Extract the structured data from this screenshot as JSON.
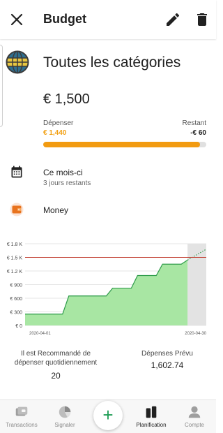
{
  "appbar": {
    "title": "Budget"
  },
  "budget": {
    "category": "Toutes les catégories",
    "amount": "€ 1,500",
    "spent_label": "Dépenser",
    "spent_value": "€ 1,440",
    "remaining_label": "Restant",
    "remaining_value": "-€ 60",
    "progress_fraction": 0.96
  },
  "period": {
    "label": "Ce mois-ci",
    "days_left": "3 jours restants"
  },
  "account": {
    "label": "Money"
  },
  "chart_data": {
    "type": "area",
    "x_start": "2020-04-01",
    "x_end": "2020-04-30",
    "x_labels": [
      "2020-04-01",
      "2020-04-30"
    ],
    "y_ticks": [
      "€ 0",
      "€ 300",
      "€ 600",
      "€ 900",
      "€ 1.2 K",
      "€ 1.5 K",
      "€ 1.8 K"
    ],
    "ylim": [
      0,
      1800
    ],
    "budget_line": 1500,
    "series": [
      {
        "points": [
          [
            "2020-04-01",
            250
          ],
          [
            "2020-04-07",
            250
          ],
          [
            "2020-04-08",
            650
          ],
          [
            "2020-04-14",
            650
          ],
          [
            "2020-04-15",
            820
          ],
          [
            "2020-04-18",
            820
          ],
          [
            "2020-04-19",
            1100
          ],
          [
            "2020-04-22",
            1100
          ],
          [
            "2020-04-23",
            1350
          ],
          [
            "2020-04-26",
            1350
          ],
          [
            "2020-04-27",
            1440
          ]
        ]
      }
    ],
    "projection": [
      [
        "2020-04-27",
        1440
      ],
      [
        "2020-04-30",
        1680
      ]
    ],
    "colors": {
      "fill": "#a8e6a3",
      "line": "#2e9b4a",
      "budget": "#c0392b",
      "future": "#e3e3e3",
      "projection": "#2e9b4a"
    }
  },
  "stats": {
    "recommended_label": "Il est Recommandé de dépenser quotidiennement",
    "recommended_value": "20",
    "forecast_label": "Dépenses Prévu",
    "forecast_value": "1,602.74"
  },
  "nav": {
    "items": [
      {
        "label": "Transactions",
        "icon": "transactions-icon"
      },
      {
        "label": "Signaler",
        "icon": "pie-chart-icon"
      },
      {
        "label": "Planification",
        "icon": "planning-icon"
      },
      {
        "label": "Compte",
        "icon": "person-icon"
      }
    ],
    "fab_label": "+"
  }
}
